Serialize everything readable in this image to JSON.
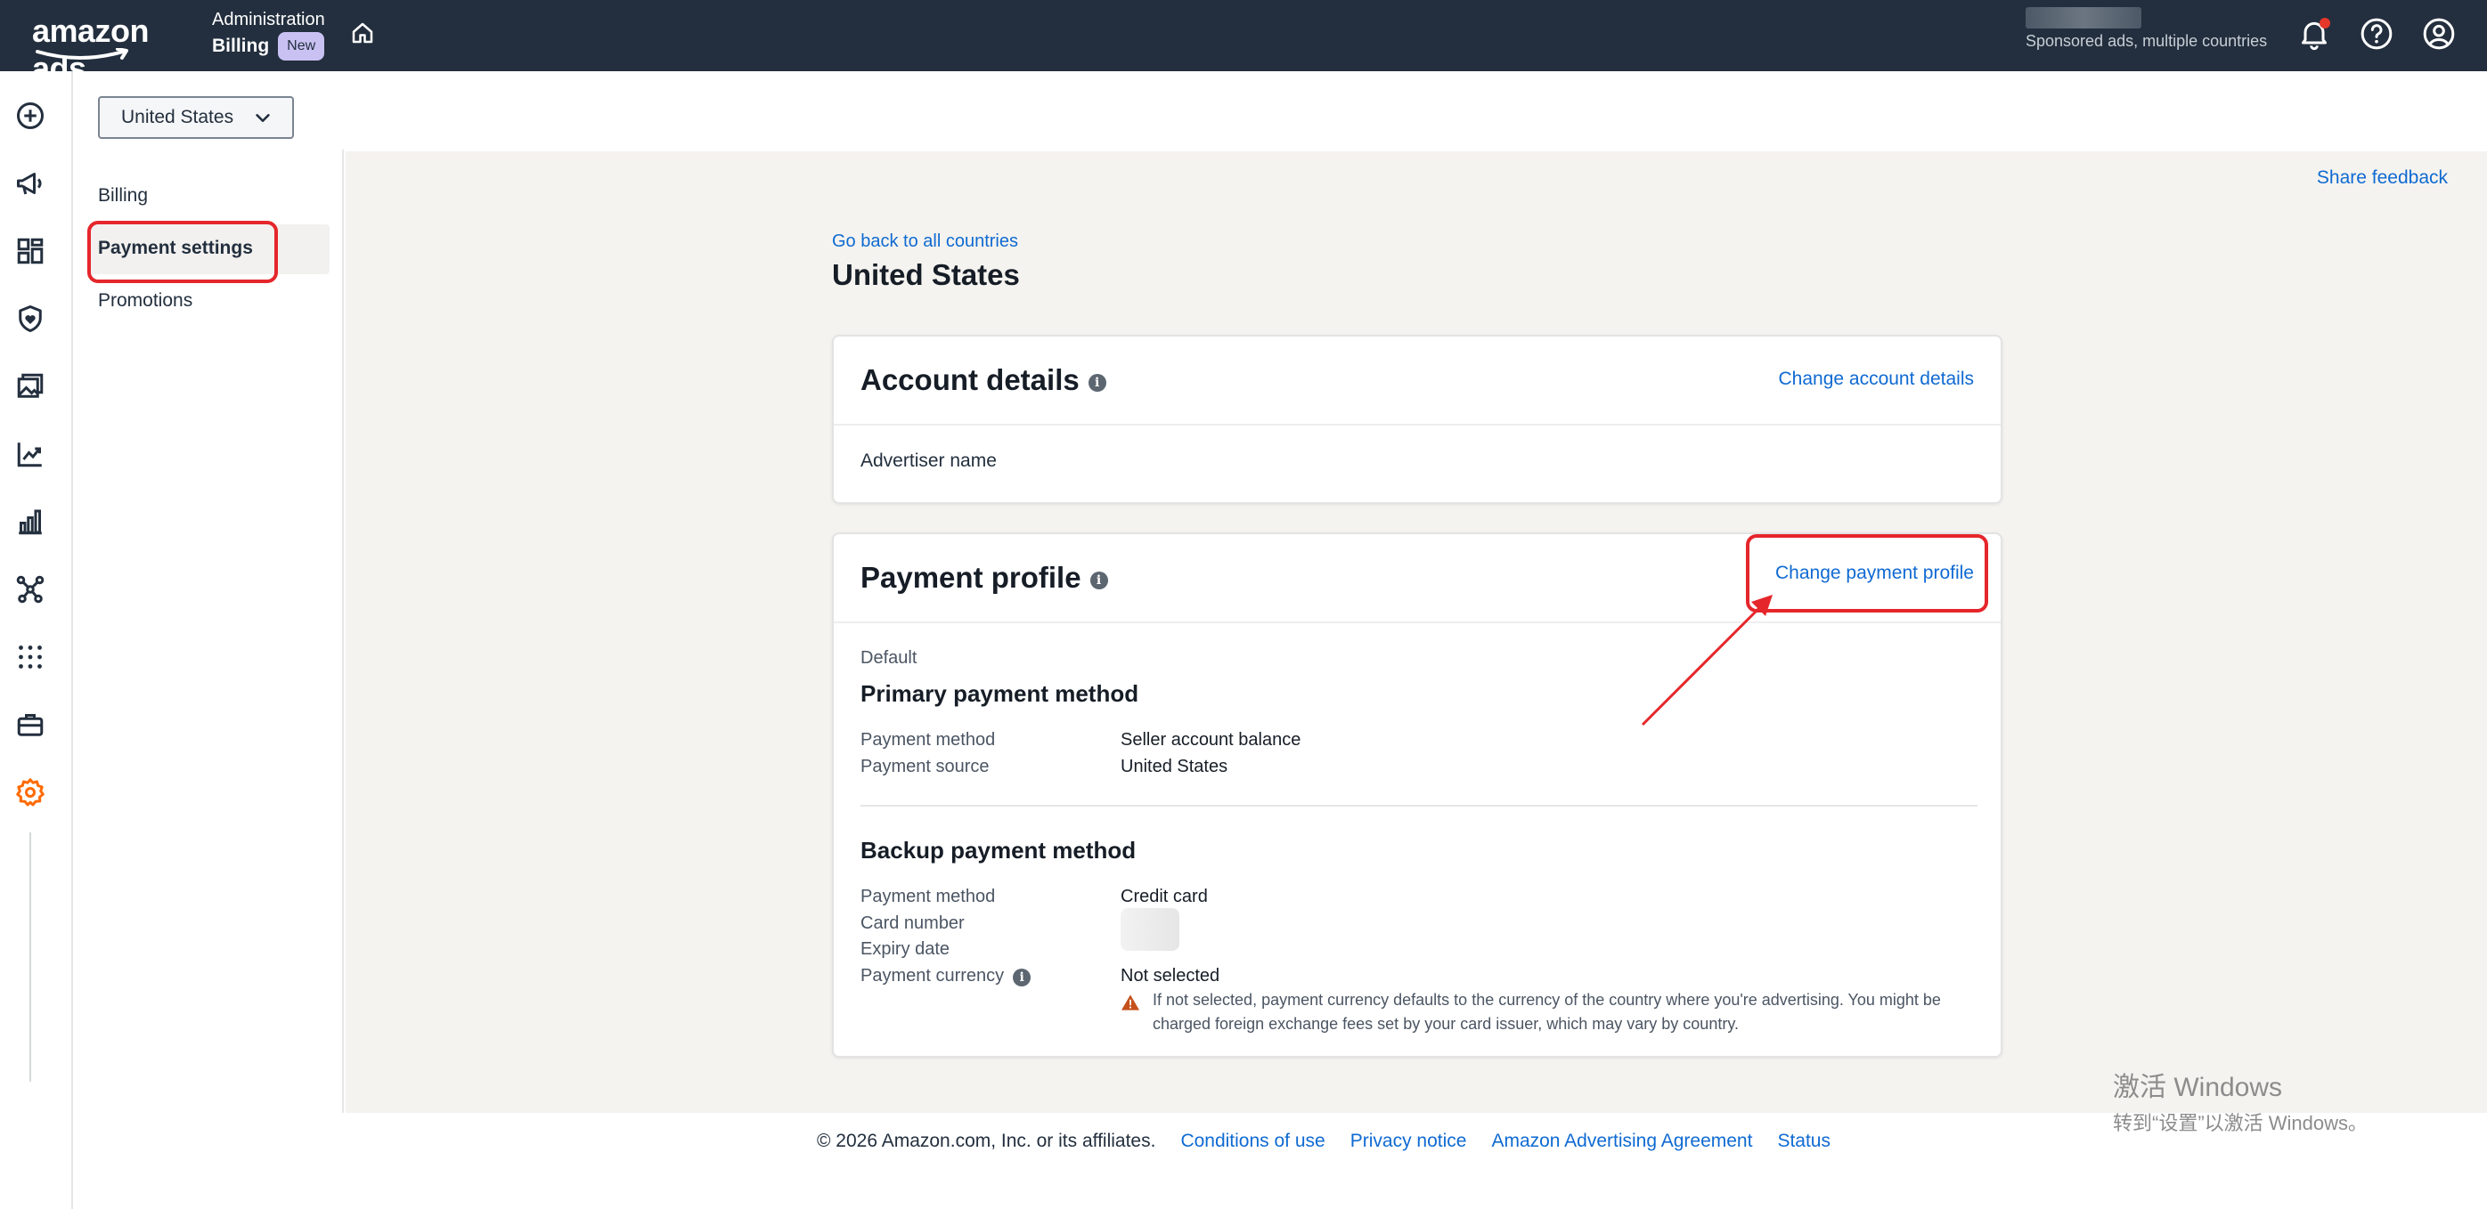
{
  "header": {
    "logo_text": "amazon ads",
    "breadcrumb_top": "Administration",
    "breadcrumb_current": "Billing",
    "badge": "New",
    "account_subtitle": "Sponsored ads, multiple countries"
  },
  "icons": {
    "rail": [
      "plus-circle-icon",
      "megaphone-icon",
      "dashboard-icon",
      "shield-icon",
      "image-icon",
      "trend-icon",
      "bar-chart-icon",
      "network-icon",
      "apps-grid-icon",
      "briefcase-icon",
      "gear-icon"
    ],
    "top": [
      "bell-icon",
      "help-icon",
      "user-icon"
    ]
  },
  "colors": {
    "topbar": "#232f3e",
    "link": "#0f6ad2",
    "highlight": "#e5262b",
    "active_rail_icon": "#ff6a00",
    "notification_dot": "#e5382b",
    "warning": "#c4501b"
  },
  "country_select": {
    "value": "United States"
  },
  "subnav": {
    "items": [
      {
        "label": "Billing"
      },
      {
        "label": "Payment settings"
      },
      {
        "label": "Promotions"
      }
    ],
    "active": "Payment settings"
  },
  "main": {
    "share_feedback": "Share feedback",
    "back_link": "Go back to all countries",
    "title": "United States"
  },
  "account_details": {
    "title": "Account details",
    "action": "Change account details",
    "advertiser_label": "Advertiser name"
  },
  "payment_profile": {
    "title": "Payment profile",
    "action": "Change payment profile",
    "default_label": "Default",
    "primary": {
      "title": "Primary payment method",
      "rows": [
        {
          "label": "Payment method",
          "value": "Seller account balance"
        },
        {
          "label": "Payment source",
          "value": "United States"
        }
      ]
    },
    "backup": {
      "title": "Backup payment method",
      "rows": [
        {
          "label": "Payment method",
          "value": "Credit card"
        },
        {
          "label": "Card number",
          "value": ""
        },
        {
          "label": "Expiry date",
          "value": ""
        },
        {
          "label": "Payment currency",
          "value": "Not selected"
        }
      ],
      "warning": "If not selected, payment currency defaults to the currency of the country where you're advertising. You might be charged foreign exchange fees set by your card issuer, which may vary by country."
    }
  },
  "footer": {
    "copyright": "© 2026 Amazon.com, Inc. or its affiliates.",
    "links": [
      "Conditions of use",
      "Privacy notice",
      "Amazon Advertising Agreement",
      "Status"
    ]
  },
  "watermark": {
    "line1": "激活 Windows",
    "line2": "转到“设置”以激活 Windows。"
  }
}
